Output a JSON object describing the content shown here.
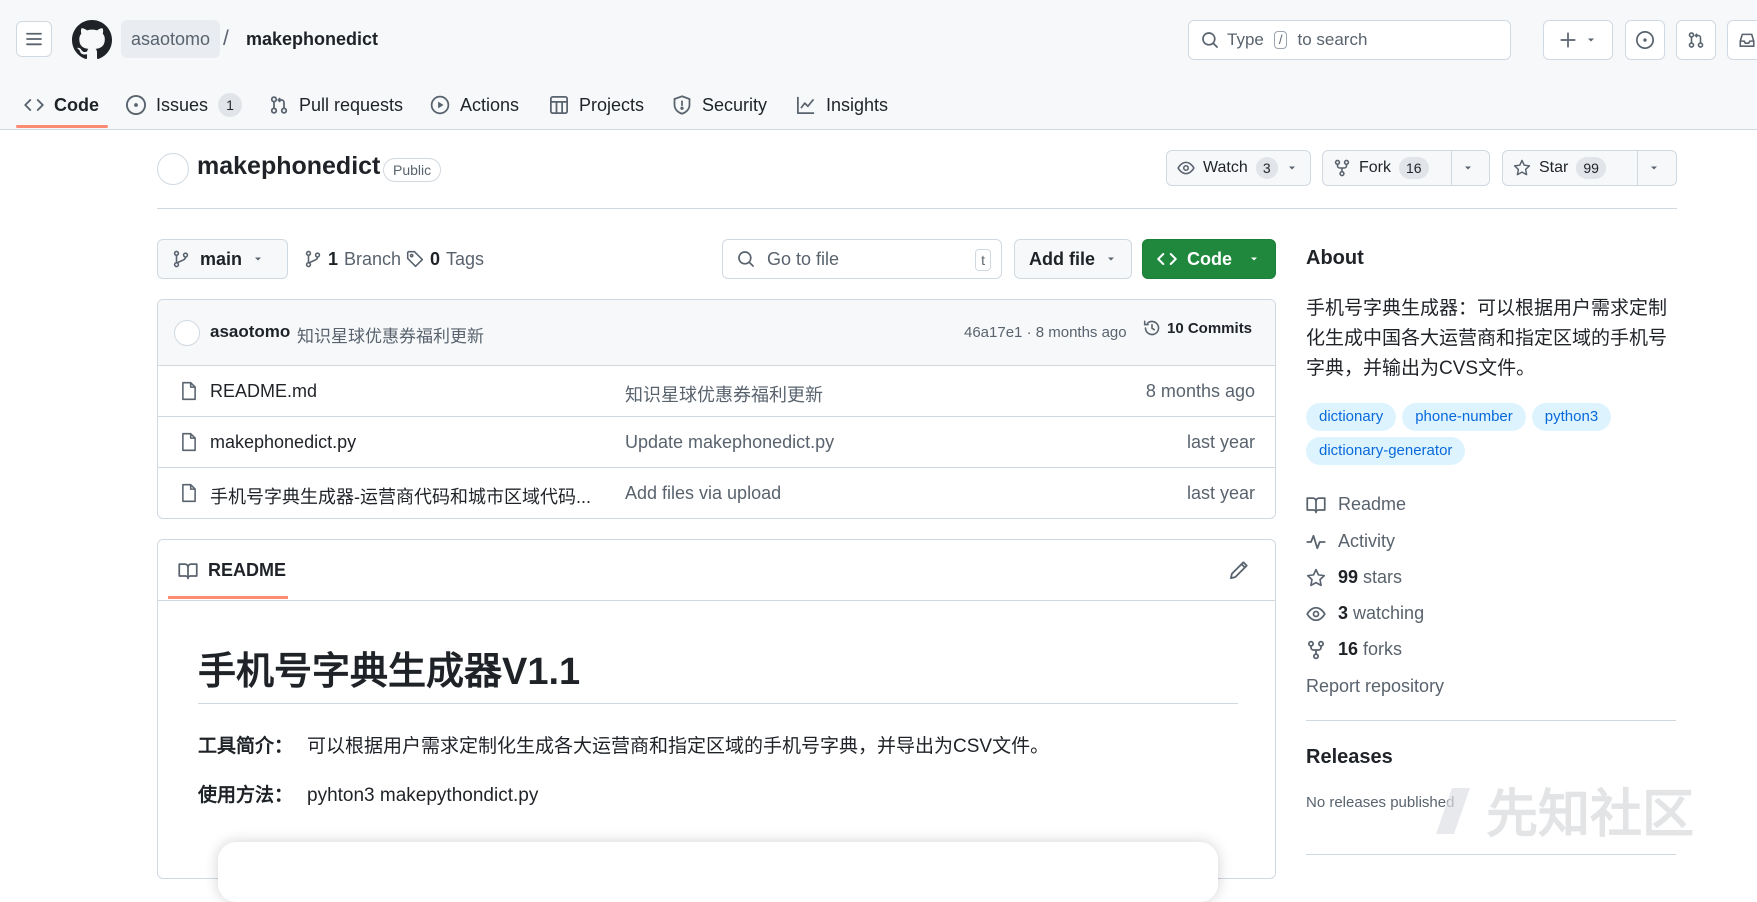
{
  "header": {
    "owner": "asaotomo",
    "separator": "/",
    "repo": "makephonedict",
    "search": {
      "prefix": "Type",
      "key": "/",
      "suffix": "to search"
    }
  },
  "tabs": [
    {
      "label": "Code",
      "icon": "code-icon",
      "selected": true
    },
    {
      "label": "Issues",
      "icon": "issue-icon",
      "count": "1"
    },
    {
      "label": "Pull requests",
      "icon": "pull-request-icon"
    },
    {
      "label": "Actions",
      "icon": "play-icon"
    },
    {
      "label": "Projects",
      "icon": "table-icon"
    },
    {
      "label": "Security",
      "icon": "shield-icon"
    },
    {
      "label": "Insights",
      "icon": "graph-icon"
    }
  ],
  "repo_header": {
    "name": "makephonedict",
    "visibility": "Public",
    "watch": {
      "label": "Watch",
      "count": "3"
    },
    "fork": {
      "label": "Fork",
      "count": "16"
    },
    "star": {
      "label": "Star",
      "count": "99"
    }
  },
  "toolbar": {
    "branch": "main",
    "branches_count": "1",
    "branches_label": "Branch",
    "tags_count": "0",
    "tags_label": "Tags",
    "goto_placeholder": "Go to file",
    "goto_key": "t",
    "add_file": "Add file",
    "code": "Code"
  },
  "latest_commit": {
    "author": "asaotomo",
    "message": "知识星球优惠券福利更新",
    "meta": "46a17e1 · 8 months ago",
    "commits": "10 Commits"
  },
  "files": [
    {
      "name": "README.md",
      "message": "知识星球优惠券福利更新",
      "time": "8 months ago"
    },
    {
      "name": "makephonedict.py",
      "message": "Update makephonedict.py",
      "time": "last year"
    },
    {
      "name": "手机号字典生成器-运营商代码和城市区域代码...",
      "message": "Add files via upload",
      "time": "last year"
    }
  ],
  "readme": {
    "tab": "README",
    "title": "手机号字典生成器V1.1",
    "intro_label": "工具简介：",
    "intro_text": "可以根据用户需求定制化生成各大运营商和指定区域的手机号字典，并导出为CSV文件。",
    "usage_label": "使用方法：",
    "usage_text": "pyhton3 makepythondict.py"
  },
  "about": {
    "heading": "About",
    "description": "手机号字典生成器：可以根据用户需求定制化生成中国各大运营商和指定区域的手机号字典，并输出为CVS文件。",
    "topics": [
      "dictionary",
      "phone-number",
      "python3",
      "dictionary-generator"
    ],
    "readme": "Readme",
    "activity": "Activity",
    "stars_count": "99",
    "stars_label": "stars",
    "watching_count": "3",
    "watching_label": "watching",
    "forks_count": "16",
    "forks_label": "forks",
    "report": "Report repository"
  },
  "releases": {
    "heading": "Releases",
    "empty": "No releases published"
  },
  "watermark": "先知社区",
  "colors": {
    "accent_green": "#1f883d",
    "topic_bg": "#ddf4ff",
    "topic_fg": "#0969da",
    "tab_underline": "#fd8c73"
  }
}
